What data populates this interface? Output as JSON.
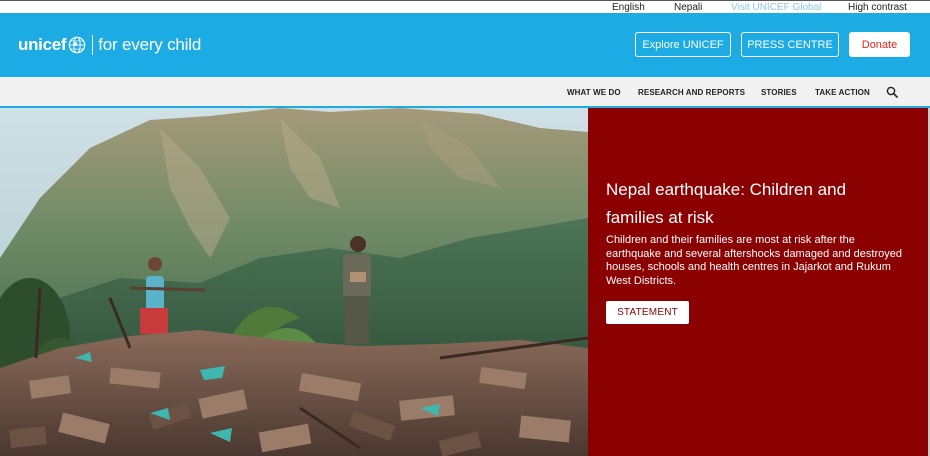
{
  "topbar": {
    "links": [
      "English",
      "Nepali",
      "Visit UNICEF Global",
      "High contrast"
    ]
  },
  "header": {
    "logo_word": "unicef",
    "logo_tagline": "for every child",
    "buttons": {
      "explore": "Explore UNICEF",
      "press": "PRESS CENTRE",
      "donate": "Donate"
    }
  },
  "nav": {
    "items": [
      "WHAT WE DO",
      "RESEARCH AND REPORTS",
      "STORIES",
      "TAKE ACTION"
    ]
  },
  "hero": {
    "title": "Nepal earthquake: Children and families at risk",
    "body": "Children and their families are most at risk after the earthquake and several aftershocks damaged and destroyed houses, schools and health centres in Jajarkot and Rukum West Districts.",
    "cta": "STATEMENT"
  },
  "colors": {
    "brand_blue": "#1cabe2",
    "panel_red": "#8b0000",
    "donate_red": "#e2231a",
    "nav_bg": "#f1f1f1",
    "global_link": "#8ac8ea"
  },
  "icons": {
    "logo": "unicef-globe-icon",
    "search": "search-icon"
  }
}
